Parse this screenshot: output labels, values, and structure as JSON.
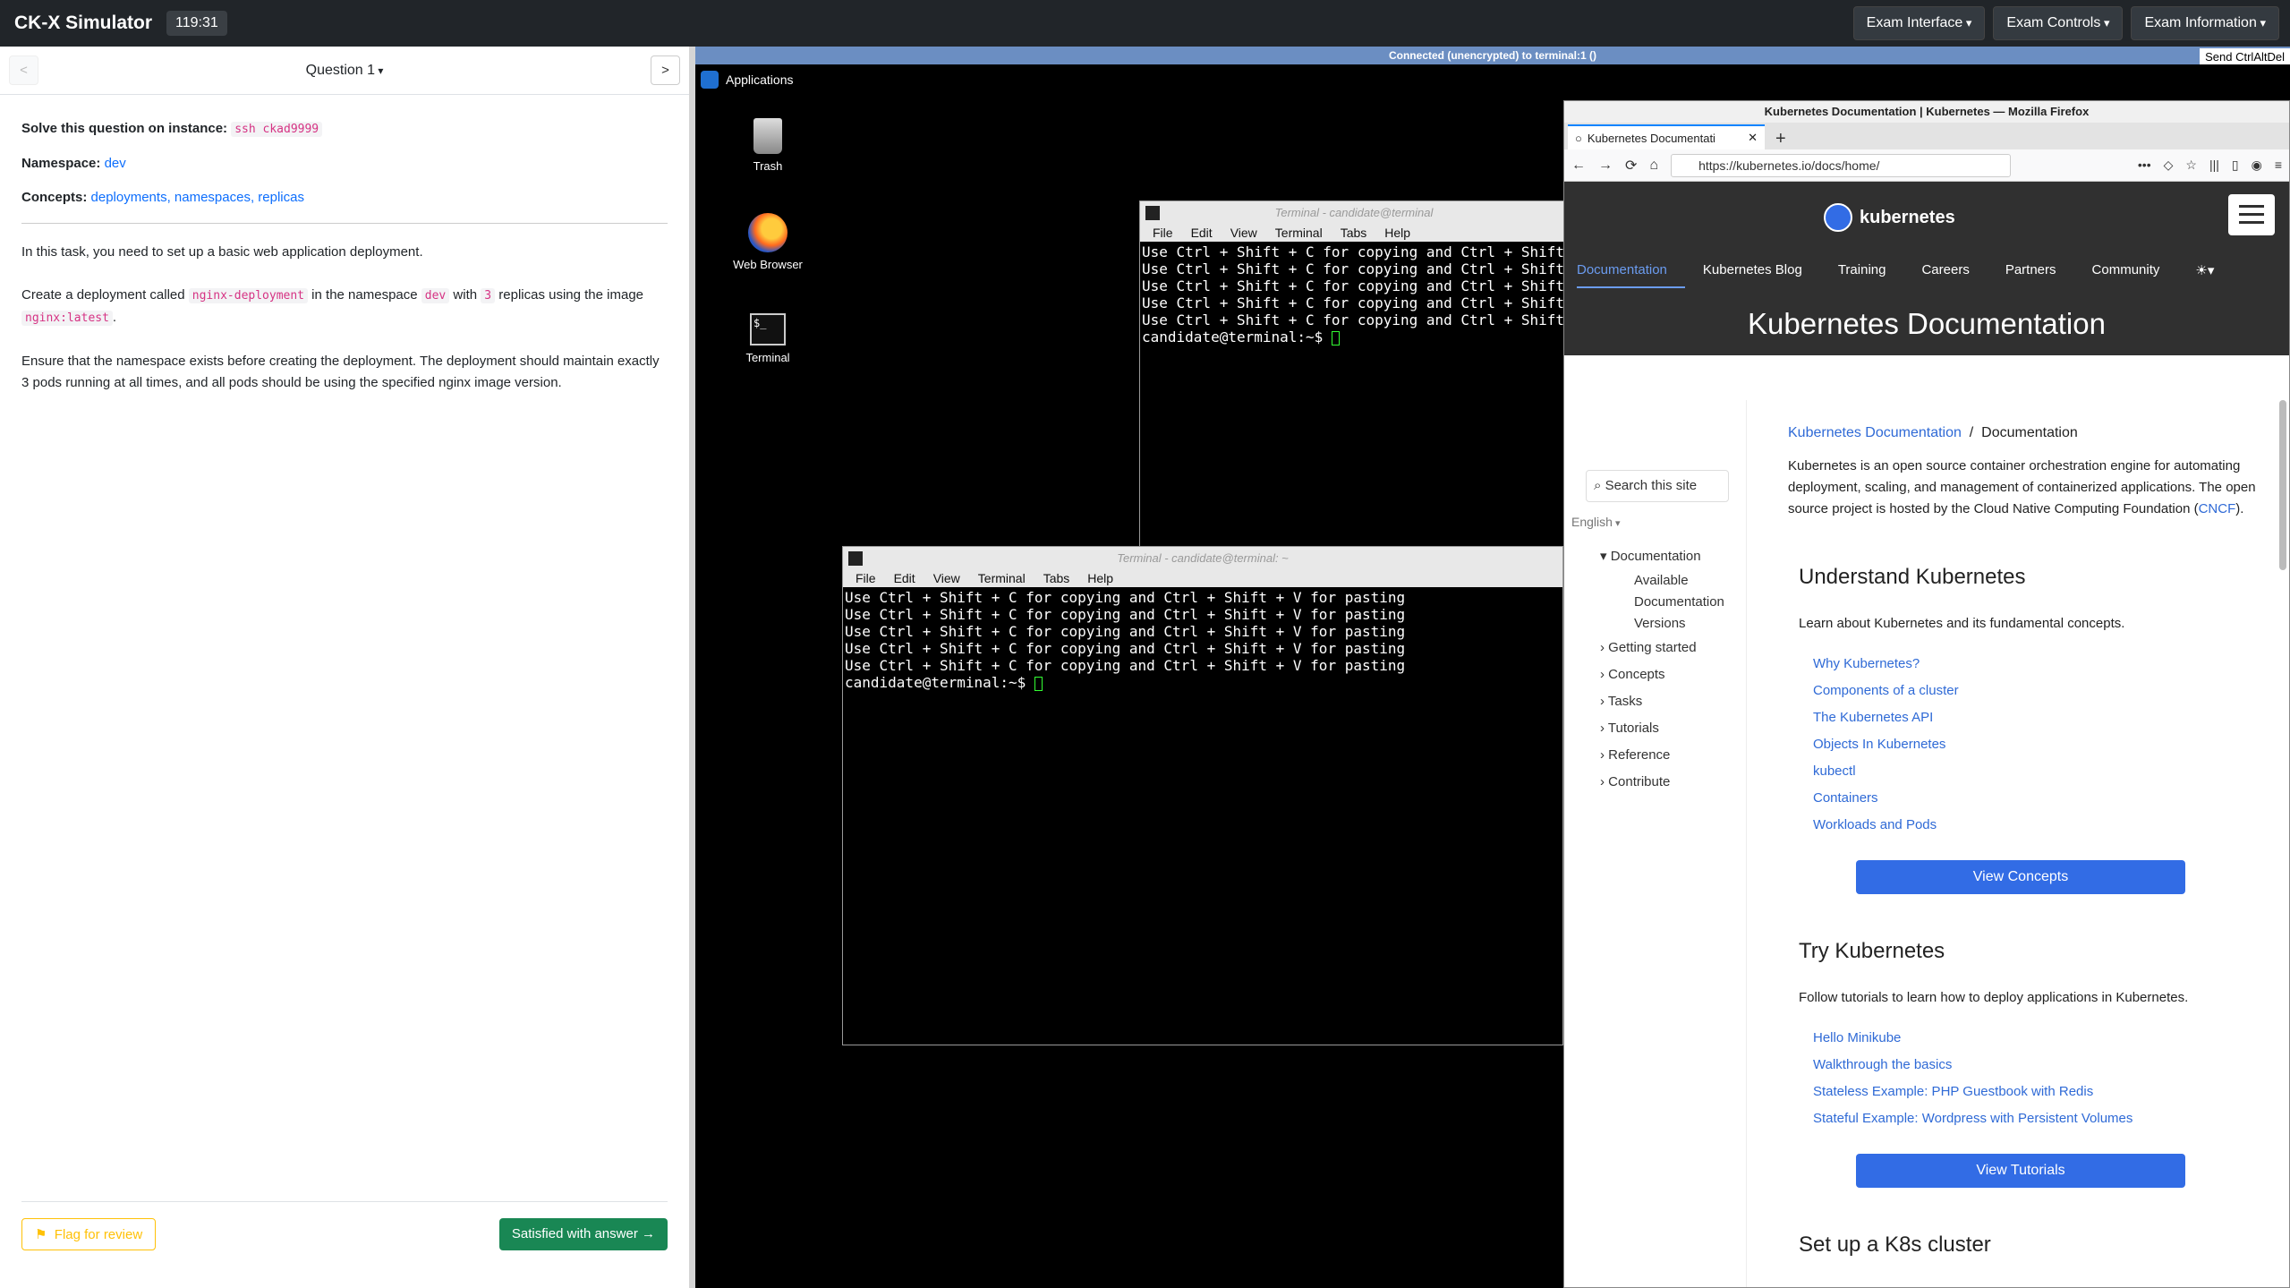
{
  "app": {
    "title": "CK-X Simulator",
    "timer": "119:31"
  },
  "topmenus": [
    "Exam Interface",
    "Exam Controls",
    "Exam Information"
  ],
  "question": {
    "nav_prev": "<",
    "nav_next": ">",
    "label": "Question 1",
    "instance_label": "Solve this question on instance:",
    "instance_value": "ssh ckad9999",
    "namespace_label": "Namespace:",
    "namespace_value": "dev",
    "concepts_label": "Concepts:",
    "concepts_value": "deployments, namespaces, replicas",
    "p1": "In this task, you need to set up a basic web application deployment.",
    "p2_a": "Create a deployment called ",
    "p2_code1": "nginx-deployment",
    "p2_b": " in the namespace ",
    "p2_code2": "dev",
    "p2_c": " with ",
    "p2_code3": "3",
    "p2_d": " replicas using the image ",
    "p2_code4": "nginx:latest",
    "p2_e": ".",
    "p3": "Ensure that the namespace exists before creating the deployment. The deployment should maintain exactly 3 pods running at all times, and all pods should be using the specified nginx image version.",
    "flag_label": "Flag for review",
    "satisfied_label": "Satisfied with answer →"
  },
  "vnc": {
    "status": "Connected (unencrypted) to terminal:1 ()",
    "send_cad": "Send CtrlAltDel"
  },
  "desktop": {
    "applications": "Applications",
    "icons": [
      "Trash",
      "Web Browser",
      "Terminal"
    ]
  },
  "terminal": {
    "title": "Terminal - candidate@terminal: ~",
    "title_back": "Terminal - candidate@terminal",
    "menu": [
      "File",
      "Edit",
      "View",
      "Terminal",
      "Tabs",
      "Help"
    ],
    "line": "Use Ctrl + Shift + C for copying and Ctrl + Shift + V for pasting",
    "prompt": "candidate@terminal:~$ "
  },
  "firefox": {
    "window_title": "Kubernetes Documentation | Kubernetes — Mozilla Firefox",
    "tab_title": "Kubernetes Documentati",
    "url": "https://kubernetes.io/docs/home/",
    "logo": "kubernetes",
    "nav": [
      "Documentation",
      "Kubernetes Blog",
      "Training",
      "Careers",
      "Partners",
      "Community"
    ],
    "page_title": "Kubernetes Documentation",
    "search_placeholder": "Search this site",
    "language": "English",
    "sidebar": [
      "Documentation",
      "Available",
      "Documentation",
      "Versions",
      "Getting started",
      "Concepts",
      "Tasks",
      "Tutorials",
      "Reference",
      "Contribute"
    ],
    "breadcrumb_link": "Kubernetes Documentation",
    "breadcrumb_sep": "/",
    "breadcrumb_current": "Documentation",
    "intro": "Kubernetes is an open source container orchestration engine for automating deployment, scaling, and management of containerized applications. The open source project is hosted by the Cloud Native Computing Foundation (",
    "intro_link": "CNCF",
    "intro_end": ").",
    "s1_title": "Understand Kubernetes",
    "s1_text": "Learn about Kubernetes and its fundamental concepts.",
    "s1_links": [
      "Why Kubernetes?",
      "Components of a cluster",
      "The Kubernetes API",
      "Objects In Kubernetes",
      "kubectl",
      "Containers",
      "Workloads and Pods"
    ],
    "s1_button": "View Concepts",
    "s2_title": "Try Kubernetes",
    "s2_text": "Follow tutorials to learn how to deploy applications in Kubernetes.",
    "s2_links": [
      "Hello Minikube",
      "Walkthrough the basics",
      "Stateless Example: PHP Guestbook with Redis",
      "Stateful Example: Wordpress with Persistent Volumes"
    ],
    "s2_button": "View Tutorials",
    "s3_title": "Set up a K8s cluster"
  }
}
